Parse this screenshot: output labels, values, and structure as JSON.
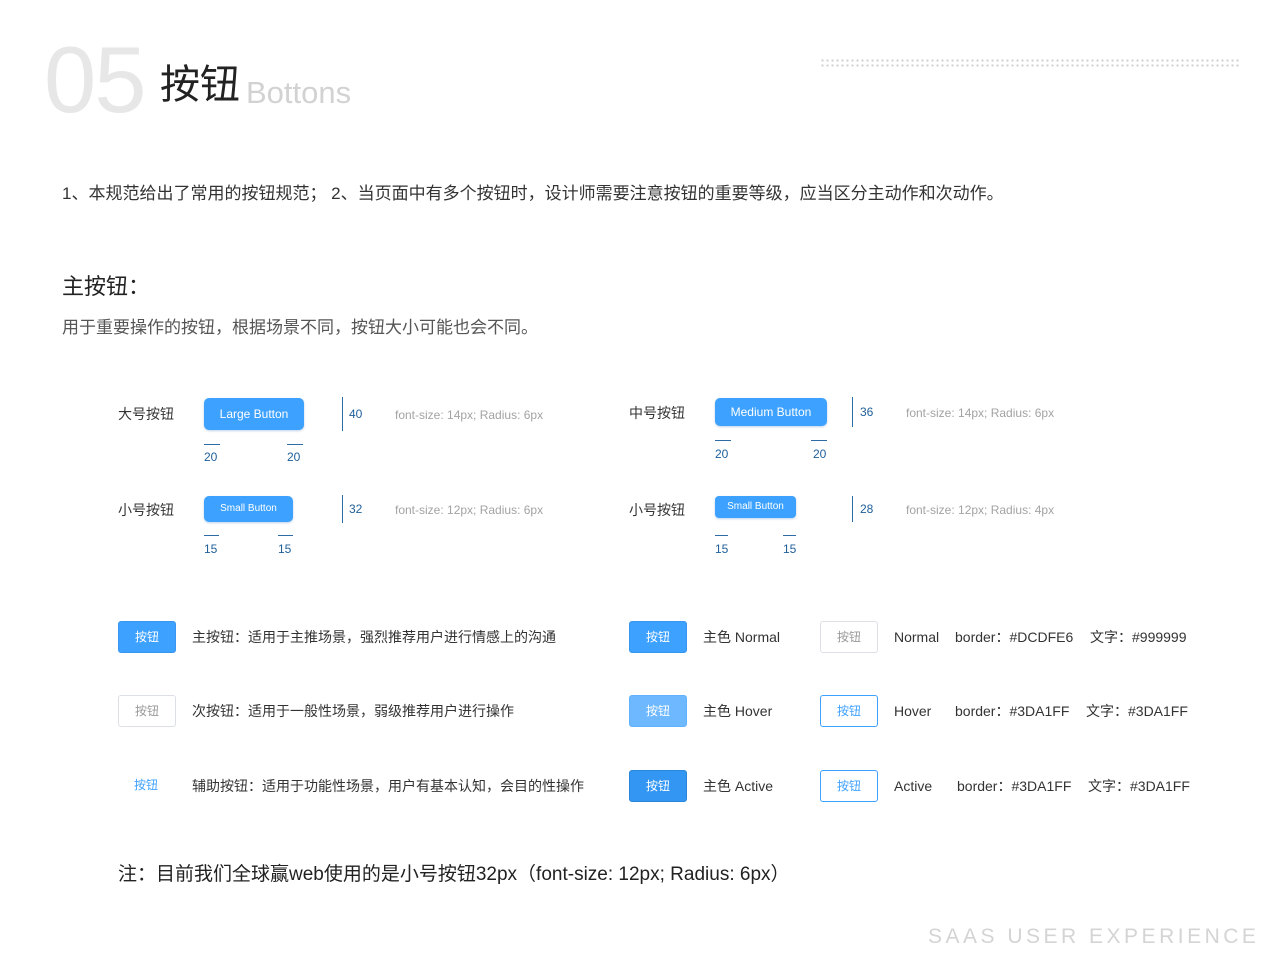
{
  "header": {
    "number": "05",
    "title": "按钮",
    "subtitle": "Bottons"
  },
  "intro": "1、本规范给出了常用的按钮规范； 2、当页面中有多个按钮时，设计师需要注意按钮的重要等级，应当区分主动作和次动作。",
  "section": {
    "title": "主按钮：",
    "desc": "用于重要操作的按钮，根据场景不同，按钮大小可能也会不同。"
  },
  "sizes": [
    {
      "label": "大号按钮",
      "button": "Large Button",
      "height": "40",
      "pad_left": "20",
      "pad_right": "20",
      "spec": "font-size: 14px; Radius: 6px"
    },
    {
      "label": "中号按钮",
      "button": "Medium Button",
      "height": "36",
      "pad_left": "20",
      "pad_right": "20",
      "spec": "font-size: 14px; Radius: 6px"
    },
    {
      "label": "小号按钮",
      "button": "Small Button",
      "height": "32",
      "pad_left": "15",
      "pad_right": "15",
      "spec": "font-size: 12px; Radius: 6px"
    },
    {
      "label": "小号按钮",
      "button": "Small Button",
      "height": "28",
      "pad_left": "15",
      "pad_right": "15",
      "spec": "font-size: 12px; Radius: 4px"
    }
  ],
  "types": [
    {
      "button": "按钮",
      "desc": "主按钮：适用于主推场景，强烈推荐用户进行情感上的沟通"
    },
    {
      "button": "按钮",
      "desc": "次按钮：适用于一般性场景，弱级推荐用户进行操作"
    },
    {
      "button": "按钮",
      "desc": "辅助按钮：适用于功能性场景，用户有基本认知，会目的性操作"
    }
  ],
  "primary_states": [
    {
      "button": "按钮",
      "label": "主色 Normal"
    },
    {
      "button": "按钮",
      "label": "主色 Hover"
    },
    {
      "button": "按钮",
      "label": "主色 Active"
    }
  ],
  "outline_states": [
    {
      "button": "按钮",
      "state": "Normal",
      "border": "border：#DCDFE6",
      "text": "文字：#999999"
    },
    {
      "button": "按钮",
      "state": "Hover",
      "border": "border：#3DA1FF",
      "text": "文字：#3DA1FF"
    },
    {
      "button": "按钮",
      "state": "Active",
      "border": "border：#3DA1FF",
      "text": "文字：#3DA1FF"
    }
  ],
  "colors": {
    "primary": "#3DA1FF",
    "border_normal": "#DCDFE6",
    "text_normal": "#999999"
  },
  "note": "注：目前我们全球赢web使用的是小号按钮32px（font-size: 12px; Radius: 6px）",
  "footer": "SAAS USER EXPERIENCE"
}
